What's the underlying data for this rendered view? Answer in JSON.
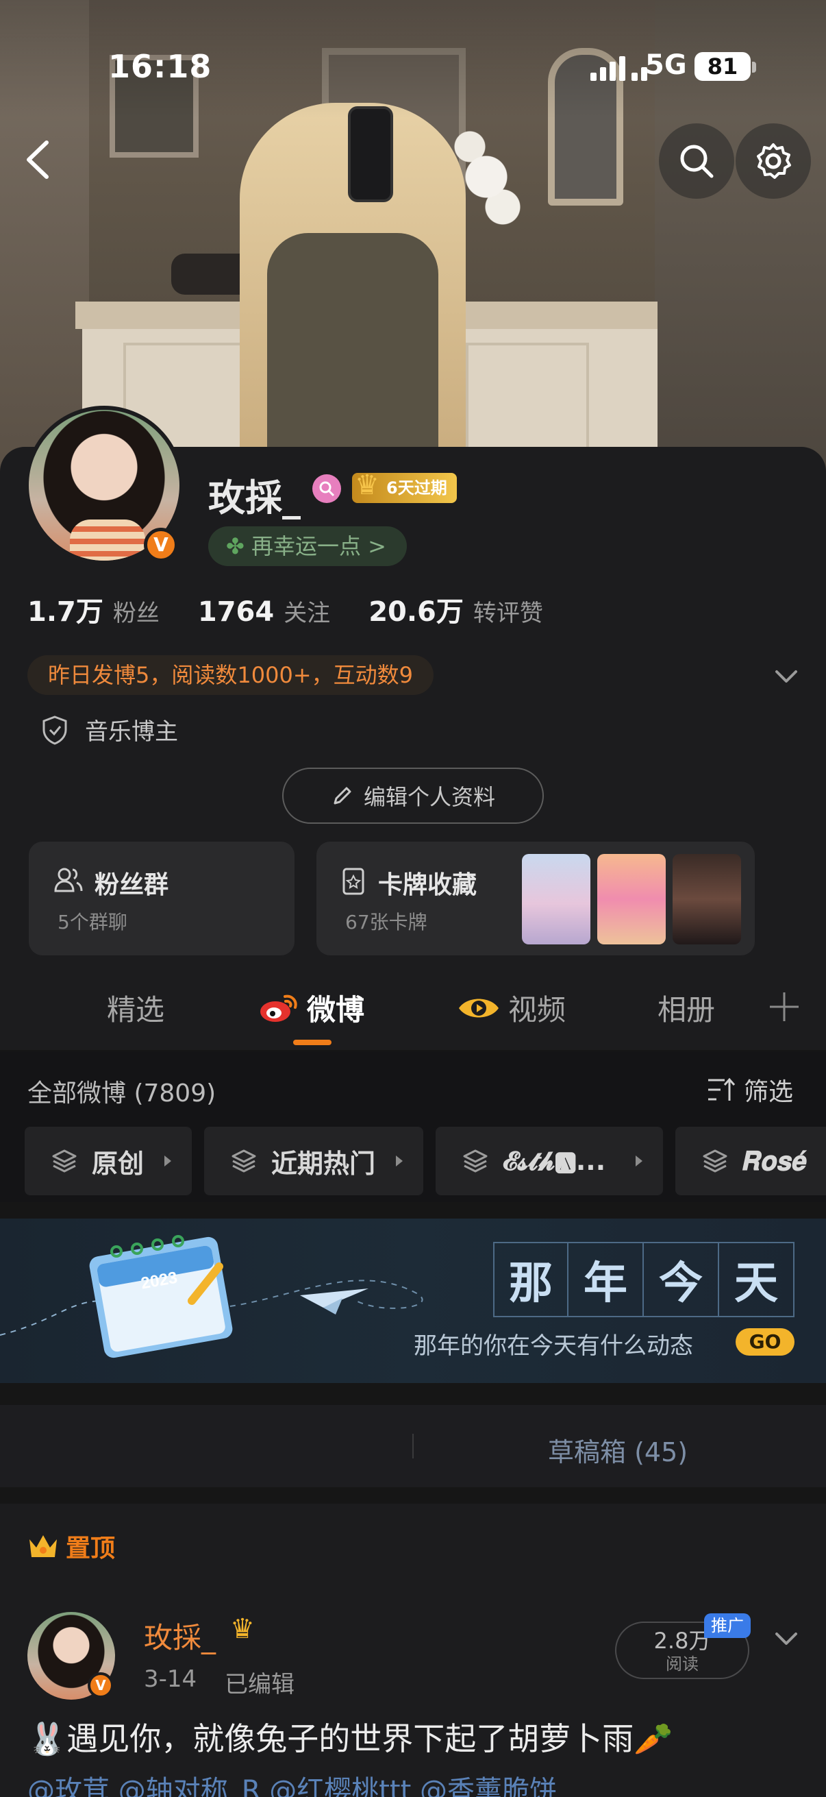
{
  "status_bar": {
    "time": "16:18",
    "network": "5G",
    "battery": "81"
  },
  "profile": {
    "name": "玫採_",
    "member_badge": "6天过期",
    "lucky_text": "再幸运一点 >",
    "verified_mark": "V",
    "stats": [
      {
        "num": "1.7万",
        "label": "粉丝"
      },
      {
        "num": "1764",
        "label": "关注"
      },
      {
        "num": "20.6万",
        "label": "转评赞"
      }
    ],
    "yesterday": "昨日发博5，阅读数1000+，互动数9",
    "tag": "音乐博主",
    "edit_label": "编辑个人资料"
  },
  "boxes": {
    "fans_title": "粉丝群",
    "fans_sub": "5个群聊",
    "cards_title": "卡牌收藏",
    "cards_sub": "67张卡牌"
  },
  "tabs": [
    "精选",
    "微博",
    "视频",
    "相册"
  ],
  "active_tab": "微博",
  "feed": {
    "all_count": "全部微博 (7809)",
    "filter_label": "筛选",
    "chips": [
      "原创",
      "近期热门",
      "𝓔𝓼𝓽𝓱🅰...",
      "𝑹𝒐𝒔𝒆́"
    ]
  },
  "banner": {
    "title_chars": [
      "那",
      "年",
      "今",
      "天"
    ],
    "subtitle": "那年的你在今天有什么动态",
    "go_label": "GO",
    "calendar_year": "2023"
  },
  "draft": {
    "label": "草稿箱 (45)"
  },
  "post": {
    "pin_label": "置顶",
    "author": "玫採_",
    "date": "3-14",
    "edited": "已编辑",
    "reads_num": "2.8万",
    "reads_label": "阅读",
    "promo_label": "推广",
    "text": "🐰遇见你，就像兔子的世界下起了胡萝卜雨🥕",
    "mentions": "@玫茸  @轴对称_R  @红樱桃ttt  @香薰脆饼"
  },
  "colors": {
    "accent": "#f07d19",
    "link": "#5a82b8",
    "background": "#1c1c1e"
  }
}
